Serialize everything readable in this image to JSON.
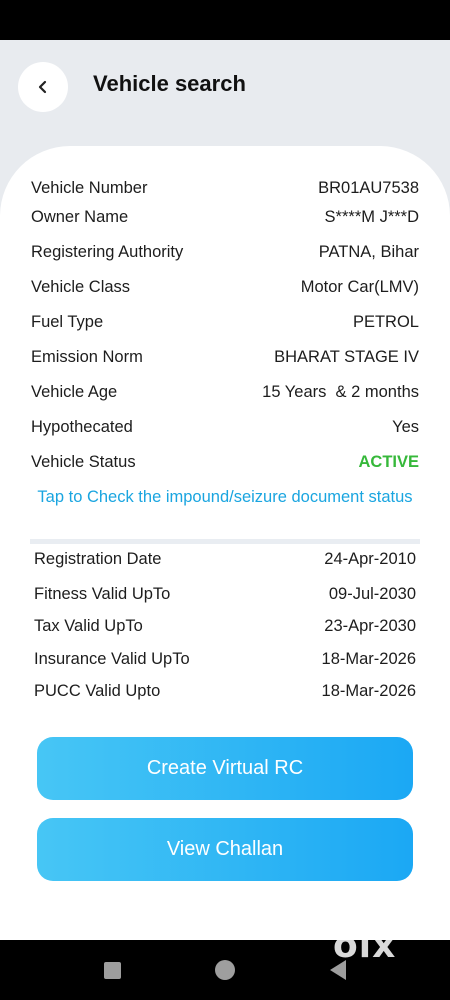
{
  "header": {
    "title": "Vehicle search"
  },
  "details": [
    {
      "label": "Vehicle Number",
      "value": "BR01AU7538"
    },
    {
      "label": "Owner Name",
      "value": "S****M J***D"
    },
    {
      "label": "Registering Authority",
      "value": "PATNA, Bihar"
    },
    {
      "label": "Vehicle Class",
      "value": "Motor Car(LMV)"
    },
    {
      "label": "Fuel Type",
      "value": "PETROL"
    },
    {
      "label": "Emission Norm",
      "value": "BHARAT STAGE IV"
    },
    {
      "label": "Vehicle Age",
      "value": "15 Years  & 2 months"
    },
    {
      "label": "Hypothecated",
      "value": "Yes"
    },
    {
      "label": "Vehicle Status",
      "value": "ACTIVE"
    }
  ],
  "impound_link": "Tap to Check the impound/seizure document status",
  "validity": [
    {
      "label": "Registration Date",
      "value": "24-Apr-2010"
    },
    {
      "label": "Fitness Valid UpTo",
      "value": "09-Jul-2030"
    },
    {
      "label": "Tax Valid UpTo",
      "value": "23-Apr-2030"
    },
    {
      "label": "Insurance Valid UpTo",
      "value": "18-Mar-2026"
    },
    {
      "label": "PUCC Valid Upto",
      "value": "18-Mar-2026"
    }
  ],
  "buttons": {
    "virtual_rc": "Create Virtual RC",
    "challan": "View Challan"
  },
  "watermark": "olx",
  "colors": {
    "accent": "#1ba8f4",
    "active": "#36b83a",
    "link": "#1aa5e0"
  },
  "icons": {
    "back": "chevron-left-icon",
    "nav_recent": "square-icon",
    "nav_home": "circle-icon",
    "nav_back": "triangle-back-icon"
  }
}
